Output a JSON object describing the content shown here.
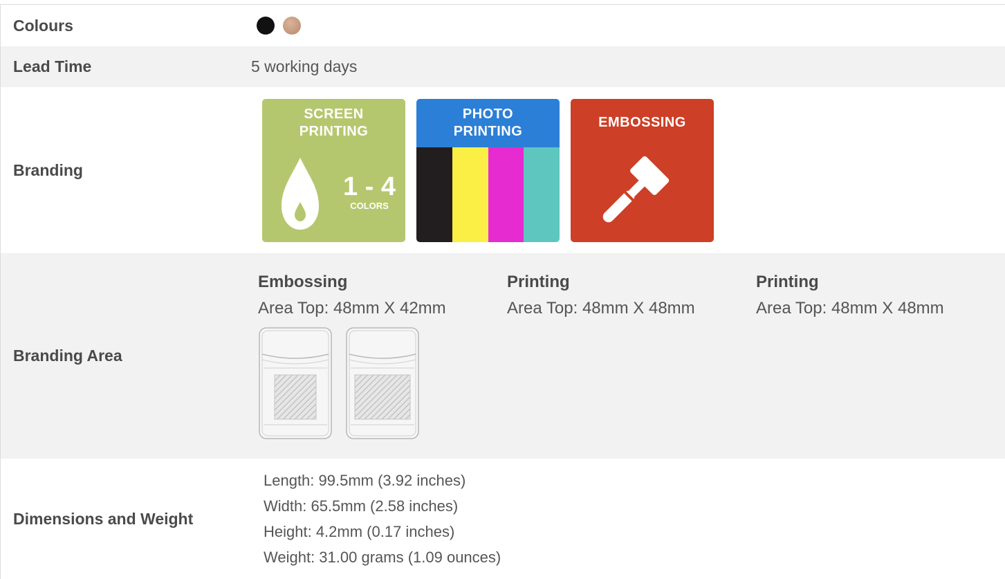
{
  "colours": {
    "label": "Colours",
    "swatches": [
      "#111111",
      "#c4987c"
    ]
  },
  "lead_time": {
    "label": "Lead Time",
    "value": "5 working days"
  },
  "branding": {
    "label": "Branding",
    "tiles": [
      {
        "line1": "SCREEN",
        "line2": "PRINTING",
        "big": "1 - 4",
        "small": "COLORS",
        "color": "#b5c76e"
      },
      {
        "line1": "PHOTO",
        "line2": "PRINTING",
        "color": "#2c7fd6",
        "bars": [
          "#221e20",
          "#fbee45",
          "#e62bd0",
          "#5ec6bf"
        ]
      },
      {
        "line1": "EMBOSSING",
        "color": "#cd3f26"
      }
    ]
  },
  "branding_area": {
    "label": "Branding Area",
    "columns": [
      {
        "title": "Embossing",
        "text": "Area Top: 48mm X 42mm"
      },
      {
        "title": "Printing",
        "text": "Area Top: 48mm X 48mm"
      },
      {
        "title": "Printing",
        "text": "Area Top: 48mm X 48mm"
      }
    ]
  },
  "dimensions": {
    "label": "Dimensions and Weight",
    "lines": [
      "Length: 99.5mm (3.92 inches)",
      "Width: 65.5mm (2.58 inches)",
      "Height: 4.2mm (0.17 inches)",
      "Weight: 31.00 grams (1.09 ounces)"
    ]
  }
}
